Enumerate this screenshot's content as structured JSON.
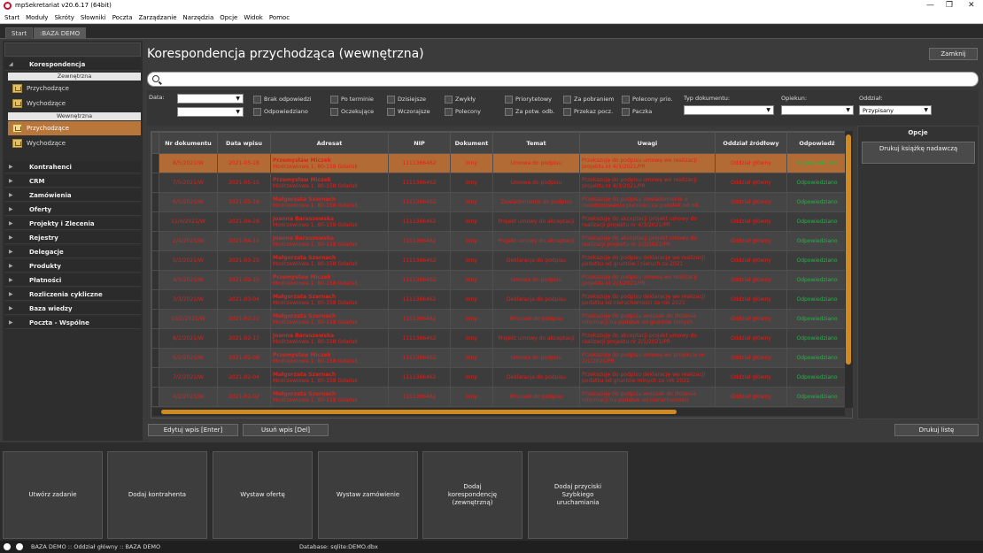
{
  "window": {
    "title": "mpSekretariat v20.6.17 (64bit)"
  },
  "menu": [
    "Start",
    "Moduły",
    "Skróty",
    "Słowniki",
    "Poczta",
    "Zarządzanie",
    "Narzędzia",
    "Opcje",
    "Widok",
    "Pomoc"
  ],
  "tabs": [
    "Start",
    ":BAZA DEMO"
  ],
  "sidebar": {
    "sections": [
      "Korespondencja",
      "Kontrahenci",
      "CRM",
      "Zamówienia",
      "Oferty",
      "Projekty i Zlecenia",
      "Rejestry",
      "Delegacje",
      "Produkty",
      "Płatności",
      "Rozliczenia cykliczne",
      "Baza wiedzy",
      "Poczta - Wspólne"
    ],
    "sub_external": "Zewnętrzna",
    "sub_internal": "Wewnętrzna",
    "items_external": [
      "Przychodzące",
      "Wychodzące"
    ],
    "items_internal": [
      "Przychodzące",
      "Wychodzące"
    ]
  },
  "main": {
    "title": "Korespondencja przychodząca (wewnętrzna)",
    "close_label": "Zamknij"
  },
  "filters": {
    "date_label": "Data:",
    "typ_label": "Typ dokumentu:",
    "opiekun_label": "Opiekun:",
    "oddzial_label": "Oddział:",
    "oddzial_value": "Przypisany",
    "checks": [
      "Brak odpowiedzi",
      "Odpowiedziano",
      "Po terminie",
      "Oczekujące",
      "Dzisiejsze",
      "Wczorajsze",
      "Zwykły",
      "Polecony",
      "Priorytetowy",
      "Za potw. odb.",
      "Za pobraniem",
      "Przekaz pocz.",
      "Polecony prio.",
      "Paczka"
    ]
  },
  "table": {
    "headers": [
      "Nr dokumentu",
      "Data wpisu",
      "Adresat",
      "NIP",
      "Dokument",
      "Temat",
      "Uwagi",
      "Oddział źródłowy",
      "Odpowiedź"
    ],
    "rows": [
      [
        "8/5/2021/W",
        "2021-05-28",
        "Przemysław Miczek",
        "Modrzewiowa 1, 80-158 Gdańsk",
        "1111366462",
        "Inny",
        "Umowa do podpisu",
        "Przekazuję do podpisu umowę we realizacji",
        "projektu nr 4/3/2021/PR",
        "Oddział główny",
        "Odpowiedziano"
      ],
      [
        "7/5/2021/W",
        "2021-05-15",
        "Przemysław Miczek",
        "Modrzewiowa 1, 80-158 Gdańsk",
        "1111366462",
        "Inny",
        "Umowa do podpisu",
        "Przekazuję do podpisu umowę we realizacji",
        "projektu nr 4/3/2021/PR",
        "Oddział główny",
        "Odpowiedziano"
      ],
      [
        "6/5/2021/W",
        "2021-05-18",
        "Małgorzata Szarnach",
        "Modrzewiowa 1, 80-158 Gdańsk",
        "1111366462",
        "Inny",
        "Zawiadomienie do podpisu",
        "Przekazuję do podpisu zawiadomienie o",
        "nieodnotowaniu płatności za podatek od nik",
        "Oddział główny",
        "Odpowiedziano"
      ],
      [
        "11/4/2021/W",
        "2021-04-28",
        "Joanna Baraszewska",
        "Modrzewiowa 1, 80-158 Gdańsk",
        "1111366462",
        "Inny",
        "Projekt umowy do akceptacji",
        "Przekazuję do akceptacji projekt umowy do",
        "realizacji projektu nr 4/3/2021/PR",
        "Oddział główny",
        "Odpowiedziano"
      ],
      [
        "2/4/2021/W",
        "2021-04-14",
        "Joanna Baraszewska",
        "Modrzewiowa 1, 80-158 Gdańsk",
        "1111366462",
        "Inny",
        "Projekt umowy do akceptacji",
        "Przekazuję do akceptacji projekt umowy do",
        "realizacji projektu nr 2/3/2021/PR",
        "Oddział główny",
        "Odpowiedziano"
      ],
      [
        "5/3/2021/W",
        "2021-03-25",
        "Małgorzata Szarnach",
        "Modrzewiowa 1, 80-158 Gdańsk",
        "1111366462",
        "Inny",
        "Deklaracja do podpisu",
        "Przekazuję do podpisu deklarację we realizacji",
        "podatku od gruntów i nieruch za 2021",
        "Oddział główny",
        "Odpowiedziano"
      ],
      [
        "4/3/2021/W",
        "2021-03-10",
        "Przemysław Miczek",
        "Modrzewiowa 1, 80-158 Gdańsk",
        "1111366462",
        "Inny",
        "Umowa do podpisu",
        "Przekazuję do podpisu umowę we realizacji",
        "projektu nr 2/3/2021/PR",
        "Oddział główny",
        "Odpowiedziano"
      ],
      [
        "3/3/2021/W",
        "2021-03-04",
        "Małgorzata Szarnach",
        "Modrzewiowa 1, 80-158 Gdańsk",
        "1111366462",
        "Inny",
        "Deklaracja do podpisu",
        "Przekazuję do podpisu deklarację we realizacji",
        "podatku od nieruchomości za rok 2021",
        "Oddział główny",
        "Odpowiedziano"
      ],
      [
        "10/2/2021/W",
        "2021-02-22",
        "Małgorzata Szarnach",
        "Modrzewiowa 1, 80-158 Gdańsk",
        "1111366462",
        "Inny",
        "Wniosek do podpisu",
        "Przekazuję do podpisu wniosek do złożenia",
        "informacji na podatek od gruntów rolnych",
        "Oddział główny",
        "Odpowiedziano"
      ],
      [
        "8/2/2021/W",
        "2021-02-17",
        "Joanna Baraszewska",
        "Modrzewiowa 1, 80-158 Gdańsk",
        "1111366462",
        "Inny",
        "Projekt umowy do akceptacji",
        "Przekazuję do akceptacji projekt umowy do",
        "realizacji projektu nr 2/1/2021/PR",
        "Oddział główny",
        "Odpowiedziano"
      ],
      [
        "5/2/2021/W",
        "2021-02-08",
        "Przemysław Miczek",
        "Modrzewiowa 1, 80-158 Gdańsk",
        "1111366462",
        "Inny",
        "Umowa do podpisu",
        "Przekazuję do podpisu umowę we projekcie nr",
        "2/1/2021/PR",
        "Oddział główny",
        "Odpowiedziano"
      ],
      [
        "7/2/2021/W",
        "2021-02-04",
        "Małgorzata Szarnach",
        "Modrzewiowa 1, 80-158 Gdańsk",
        "1111366462",
        "Inny",
        "Deklaracja do podpisu",
        "Przekazuję do podpisu deklarację we realizacji",
        "podatku od gruntów rolnych za rok 2021",
        "Oddział główny",
        "Odpowiedziano"
      ],
      [
        "4/2/2021/W",
        "2021-02-02",
        "Małgorzata Szarnach",
        "Modrzewiowa 1, 80-158 Gdańsk",
        "1111366462",
        "Inny",
        "Wniosek do podpisu",
        "Przekazuję do podpisu wniosek do złożenia",
        "informacji na podatek od nieruchomości",
        "Oddział główny",
        "Odpowiedziano"
      ]
    ]
  },
  "opcje": {
    "title": "Opcje",
    "print_book": "Drukuj książkę nadawczą"
  },
  "actions": {
    "edit": "Edytuj wpis [Enter]",
    "delete": "Usuń wpis [Del]",
    "print": "Drukuj listę"
  },
  "tiles": [
    "Utwórz zadanie",
    "Dodaj kontrahenta",
    "Wystaw ofertę",
    "Wystaw zamówienie",
    "Dodaj korespondencję (zewnętrzną)",
    "Dodaj przyciski Szybkiego uruchamiania"
  ],
  "status": {
    "left": "BAZA DEMO :: Oddział główny :: BAZA DEMO",
    "db": "Database: sqlite:DEMO.dbx"
  }
}
